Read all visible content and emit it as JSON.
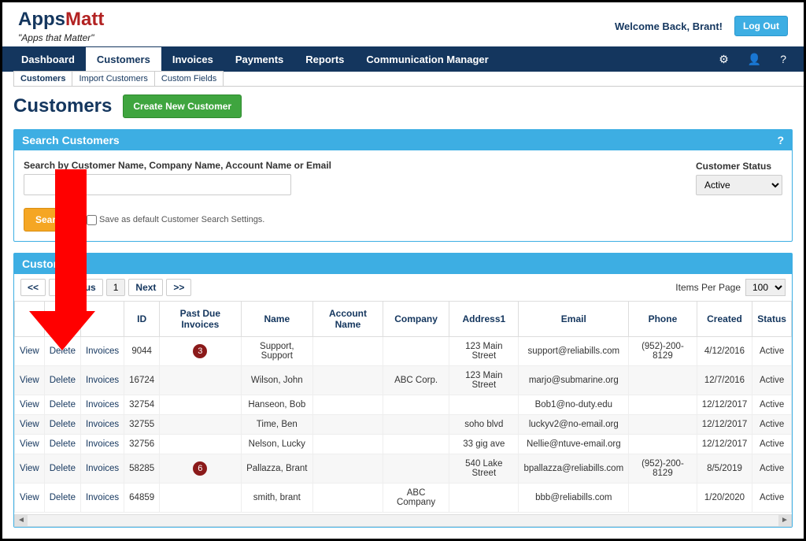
{
  "logo": {
    "apps": "Apps",
    "matt": "Matt",
    "tagline": "\"Apps that Matter\""
  },
  "header": {
    "welcome": "Welcome Back, Brant!",
    "logout": "Log Out"
  },
  "nav": {
    "tabs": [
      "Dashboard",
      "Customers",
      "Invoices",
      "Payments",
      "Reports",
      "Communication Manager"
    ],
    "active": "Customers"
  },
  "subtabs": {
    "items": [
      "Customers",
      "Import Customers",
      "Custom Fields"
    ],
    "active": "Customers"
  },
  "page": {
    "title": "Customers",
    "create_btn": "Create New Customer"
  },
  "search_panel": {
    "title": "Search Customers",
    "field_label": "Search by Customer Name, Company Name, Account Name or Email",
    "status_label": "Customer Status",
    "status_value": "Active",
    "search_btn": "Search",
    "save_default": "Save as default Customer Search Settings."
  },
  "list_panel": {
    "title": "Customers",
    "pager": {
      "first": "<<",
      "prev": "Previous",
      "page": "1",
      "next": "Next",
      "last": ">>",
      "items_label": "Items Per Page",
      "items_value": "100"
    },
    "columns": [
      "",
      "",
      "",
      "ID",
      "Past Due Invoices",
      "Name",
      "Account Name",
      "Company",
      "Address1",
      "Email",
      "Phone",
      "Created",
      "Status"
    ],
    "row_actions": {
      "view": "View",
      "delete": "Delete",
      "invoices": "Invoices"
    },
    "rows": [
      {
        "id": "9044",
        "past_due": "3",
        "name": "Support, Support",
        "account": "",
        "company": "",
        "address": "123 Main Street",
        "email": "support@reliabills.com",
        "phone": "(952)-200-8129",
        "created": "4/12/2016",
        "status": "Active"
      },
      {
        "id": "16724",
        "past_due": "",
        "name": "Wilson, John",
        "account": "",
        "company": "ABC Corp.",
        "address": "123 Main Street",
        "email": "marjo@submarine.org",
        "phone": "",
        "created": "12/7/2016",
        "status": "Active"
      },
      {
        "id": "32754",
        "past_due": "",
        "name": "Hanseon, Bob",
        "account": "",
        "company": "",
        "address": "",
        "email": "Bob1@no-duty.edu",
        "phone": "",
        "created": "12/12/2017",
        "status": "Active"
      },
      {
        "id": "32755",
        "past_due": "",
        "name": "Time, Ben",
        "account": "",
        "company": "",
        "address": "soho blvd",
        "email": "luckyv2@no-email.org",
        "phone": "",
        "created": "12/12/2017",
        "status": "Active"
      },
      {
        "id": "32756",
        "past_due": "",
        "name": "Nelson, Lucky",
        "account": "",
        "company": "",
        "address": "33 gig ave",
        "email": "Nellie@ntuve-email.org",
        "phone": "",
        "created": "12/12/2017",
        "status": "Active"
      },
      {
        "id": "58285",
        "past_due": "6",
        "name": "Pallazza, Brant",
        "account": "",
        "company": "",
        "address": "540 Lake Street",
        "email": "bpallazza@reliabills.com",
        "phone": "(952)-200-8129",
        "created": "8/5/2019",
        "status": "Active"
      },
      {
        "id": "64859",
        "past_due": "",
        "name": "smith, brant",
        "account": "",
        "company": "ABC Company",
        "address": "",
        "email": "bbb@reliabills.com",
        "phone": "",
        "created": "1/20/2020",
        "status": "Active"
      }
    ]
  }
}
